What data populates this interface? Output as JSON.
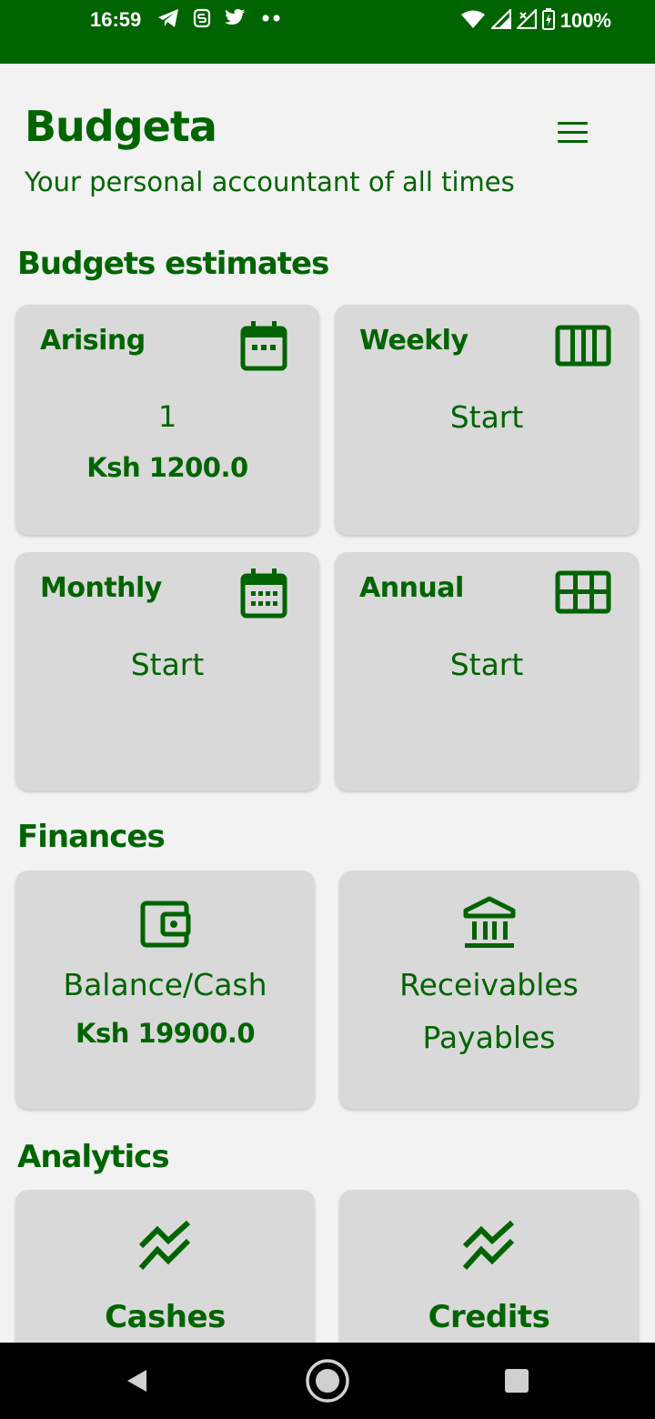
{
  "status_bar": {
    "time": "16:59",
    "battery_text": "100%",
    "icons": [
      "telegram-icon",
      "s-app-icon",
      "twitter-icon",
      "more-dots-icon",
      "wifi-icon",
      "signal-icon",
      "signal-x-icon",
      "battery-charging-icon"
    ]
  },
  "header": {
    "title": "Budgeta",
    "subtitle": "Your personal accountant of all times",
    "menu_icon": "hamburger-menu-icon"
  },
  "budgets": {
    "section_title": "Budgets estimates",
    "arising": {
      "label": "Arising",
      "count": "1",
      "amount": "Ksh 1200.0",
      "icon": "calendar-dots-icon"
    },
    "weekly": {
      "label": "Weekly",
      "action": "Start",
      "icon": "view-week-icon"
    },
    "monthly": {
      "label": "Monthly",
      "action": "Start",
      "icon": "calendar-month-icon"
    },
    "annual": {
      "label": "Annual",
      "action": "Start",
      "icon": "view-module-icon"
    }
  },
  "finances": {
    "section_title": "Finances",
    "balance": {
      "label": "Balance/Cash",
      "amount": "Ksh 19900.0",
      "icon": "wallet-icon"
    },
    "receivables": {
      "line1": "Receivables",
      "line2": "Payables",
      "icon": "bank-icon"
    }
  },
  "analytics": {
    "section_title": "Analytics",
    "cashes": {
      "label": "Cashes",
      "icon": "stacked-line-chart-icon"
    },
    "credits": {
      "label": "Credits",
      "icon": "stacked-line-chart-icon"
    }
  },
  "nav_bar": {
    "icons": [
      "back-icon",
      "home-icon",
      "recents-icon"
    ]
  },
  "colors": {
    "primary": "#006400",
    "background": "#f2f2f2",
    "card": "#d9d9d9",
    "nav_bar": "#000000"
  }
}
